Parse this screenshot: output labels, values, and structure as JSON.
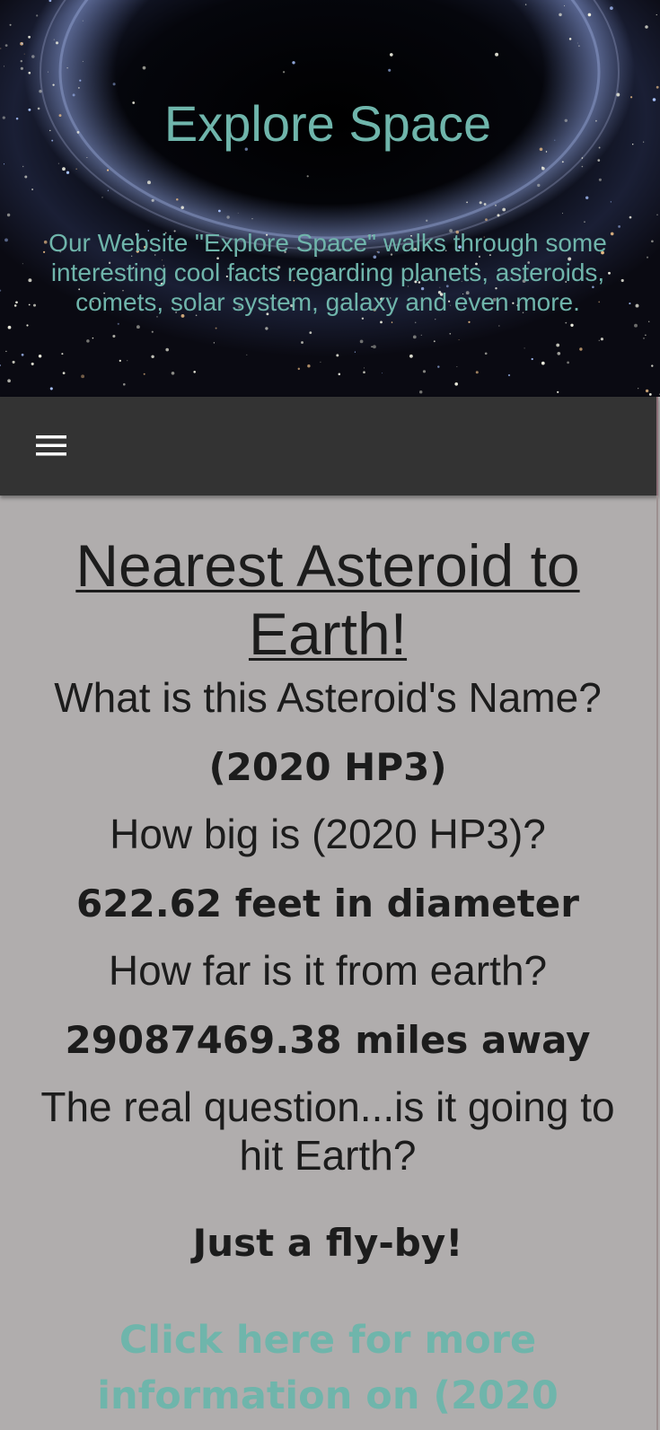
{
  "header": {
    "title": "Explore Space",
    "description": "Our Website \"Explore Space\" walks through some interesting cool facts regarding planets, asteroids, comets, solar system, galaxy and even more."
  },
  "nav": {
    "menu_icon": "hamburger-menu-icon"
  },
  "main": {
    "heading": "Nearest Asteroid to Earth!",
    "q_name": "What is this Asteroid's Name?",
    "a_name": "(2020 HP3)",
    "q_size": "How big is (2020 HP3)?",
    "a_size": "622.62 feet in diameter",
    "q_distance": "How far is it from earth?",
    "a_distance": "29087469.38 miles away",
    "q_hit": "The real question...is it going to hit Earth?",
    "a_hit": "Just a fly-by!",
    "more_link": "Click here for more information on (2020"
  },
  "colors": {
    "accent": "#6fb5ab",
    "nav_bg": "#333333",
    "page_bg": "#b0adad",
    "text": "#1c1c1c"
  }
}
